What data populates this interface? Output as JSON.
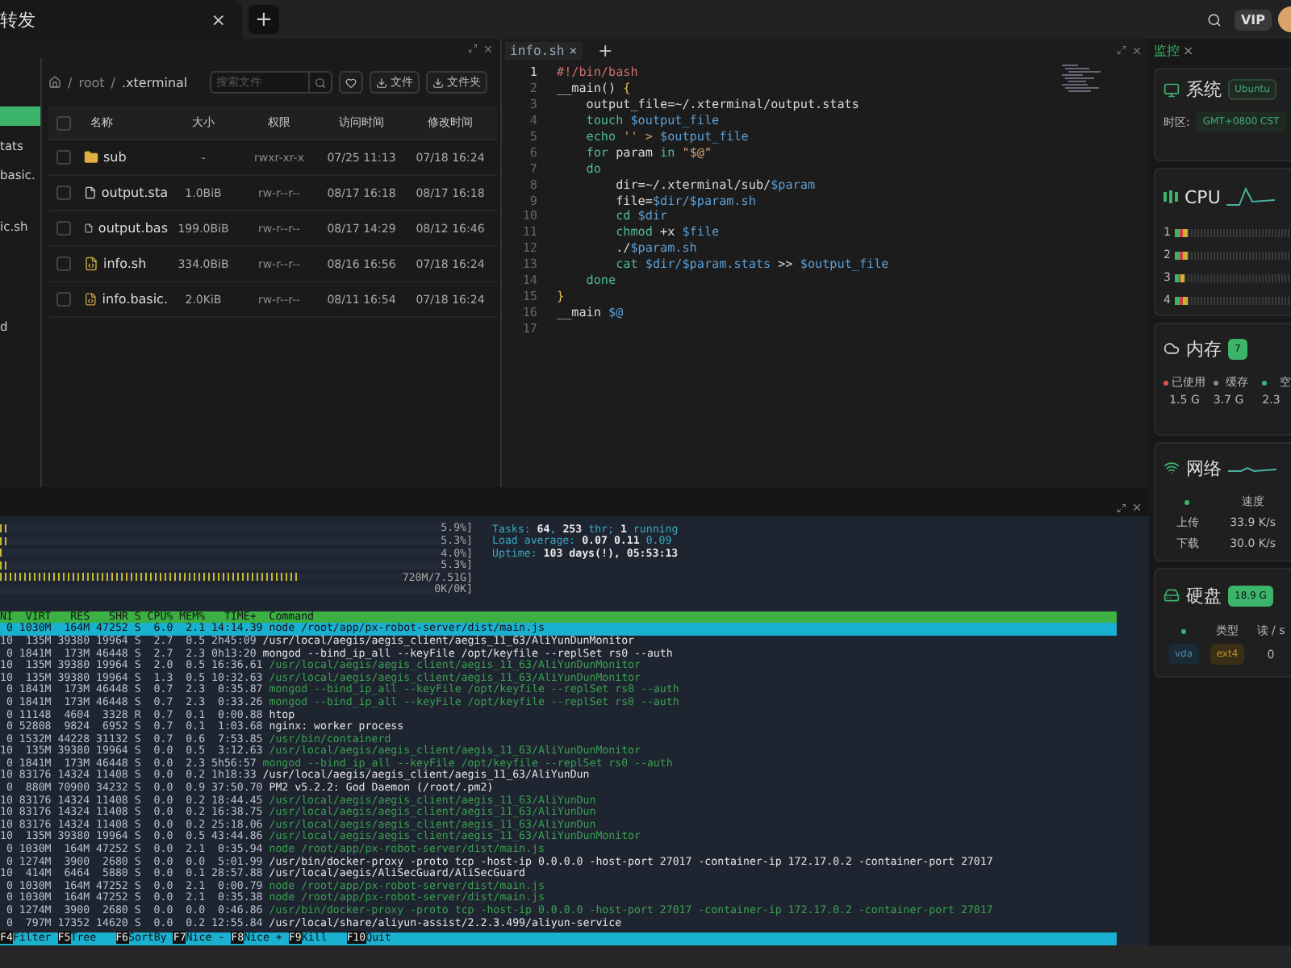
{
  "top_bar": {
    "tab": {
      "label": "转发",
      "close": "×"
    },
    "new_tab": "+",
    "vip": "VIP"
  },
  "sidebar": {
    "items": [
      {
        "label": "tats"
      },
      {
        "label": "basic."
      },
      {
        "label": "ic.sh"
      },
      {
        "label": "d"
      }
    ]
  },
  "file_manager": {
    "breadcrumb": [
      "root",
      ".xterminal"
    ],
    "separator": "/",
    "search": {
      "placeholder": "搜索文件"
    },
    "buttons": [
      "文件",
      "文件夹"
    ],
    "all_selected": false,
    "columns": [
      "名称",
      "大小",
      "权限",
      "访问时间",
      "修改时间"
    ],
    "rows": [
      {
        "kind": "folder",
        "name": "sub",
        "size": "-",
        "perm": "rwxr-xr-x",
        "accessed": "07/25 11:13",
        "modified": "07/18 16:24",
        "checked": false
      },
      {
        "kind": "file",
        "name": "output.sta",
        "size": "1.0BiB",
        "perm": "rw-r--r--",
        "accessed": "08/17 16:18",
        "modified": "08/17 16:18",
        "checked": false
      },
      {
        "kind": "file",
        "name": "output.bas",
        "size": "199.0BiB",
        "perm": "rw-r--r--",
        "accessed": "08/17 14:29",
        "modified": "08/12 16:46",
        "checked": false
      },
      {
        "kind": "script",
        "name": "info.sh",
        "size": "334.0BiB",
        "perm": "rw-r--r--",
        "accessed": "08/16 16:56",
        "modified": "07/18 16:24",
        "checked": false
      },
      {
        "kind": "script",
        "name": "info.basic.",
        "size": "2.0KiB",
        "perm": "rw-r--r--",
        "accessed": "08/11 16:54",
        "modified": "07/18 16:24",
        "checked": false
      }
    ]
  },
  "editor": {
    "tab": {
      "label": "info.sh",
      "close": "×"
    },
    "new_tab": "+",
    "lines": [
      {
        "number": "1",
        "tokens": [
          {
            "kind": "comment",
            "text": "#!/bin/bash"
          }
        ]
      },
      {
        "number": "2",
        "tokens": [
          {
            "kind": "plain",
            "text": "__main() "
          },
          {
            "kind": "brace",
            "text": "{"
          }
        ]
      },
      {
        "number": "3",
        "tokens": [
          {
            "kind": "plain",
            "text": "    output_file=~/.xterminal/output.stats"
          }
        ]
      },
      {
        "number": "4",
        "tokens": [
          {
            "kind": "keyword",
            "text": "    touch"
          },
          {
            "kind": "variable",
            "text": " $output_file"
          }
        ]
      },
      {
        "number": "5",
        "tokens": [
          {
            "kind": "keyword",
            "text": "    echo"
          },
          {
            "kind": "string",
            "text": " '' > "
          },
          {
            "kind": "variable",
            "text": "$output_file"
          }
        ]
      },
      {
        "number": "6",
        "tokens": [
          {
            "kind": "keyword",
            "text": "    for"
          },
          {
            "kind": "plain",
            "text": " param "
          },
          {
            "kind": "keyword",
            "text": "in"
          },
          {
            "kind": "string",
            "text": " \"$@\""
          }
        ]
      },
      {
        "number": "7",
        "tokens": [
          {
            "kind": "keyword",
            "text": "    do"
          }
        ]
      },
      {
        "number": "8",
        "tokens": [
          {
            "kind": "plain",
            "text": "        dir=~/.xterminal/sub/"
          },
          {
            "kind": "variable",
            "text": "$param"
          }
        ]
      },
      {
        "number": "9",
        "tokens": [
          {
            "kind": "plain",
            "text": "        file="
          },
          {
            "kind": "variable",
            "text": "$dir/$param.sh"
          }
        ]
      },
      {
        "number": "10",
        "tokens": [
          {
            "kind": "keyword",
            "text": "        cd"
          },
          {
            "kind": "variable",
            "text": " $dir"
          }
        ]
      },
      {
        "number": "11",
        "tokens": [
          {
            "kind": "keyword",
            "text": "        chmod"
          },
          {
            "kind": "plain",
            "text": " +x"
          },
          {
            "kind": "variable",
            "text": " $file"
          }
        ]
      },
      {
        "number": "12",
        "tokens": [
          {
            "kind": "plain",
            "text": "        ./"
          },
          {
            "kind": "variable",
            "text": "$param.sh"
          }
        ]
      },
      {
        "number": "13",
        "tokens": [
          {
            "kind": "keyword",
            "text": "        cat"
          },
          {
            "kind": "variable",
            "text": " $dir/$param.stats"
          },
          {
            "kind": "plain",
            "text": " >> "
          },
          {
            "kind": "variable",
            "text": "$output_file"
          }
        ]
      },
      {
        "number": "14",
        "tokens": [
          {
            "kind": "keyword",
            "text": "    done"
          }
        ]
      },
      {
        "number": "15",
        "tokens": [
          {
            "kind": "brace",
            "text": "}"
          }
        ]
      },
      {
        "number": "16",
        "tokens": [
          {
            "kind": "plain",
            "text": "__main"
          },
          {
            "kind": "variable",
            "text": " $@"
          }
        ]
      },
      {
        "number": "17"
      }
    ]
  },
  "terminal": {
    "meters": [
      {
        "reading": "5.9%]",
        "level": 0.02
      },
      {
        "reading": "5.3%]",
        "level": 0.02
      },
      {
        "reading": "4.0%]",
        "level": 0.01
      },
      {
        "reading": "5.3%]",
        "level": 0.02
      },
      {
        "reading": "720M/7.51G]",
        "level": 0.74
      },
      {
        "reading": "0K/0K]",
        "level": 0
      }
    ],
    "summary": [
      "Tasks: **64**, **253** thr; **1** running",
      "Load average: **0.07** **0.11** 0.09",
      "Uptime: **103 days(!), 05:53:13**"
    ],
    "header": "NI  VIRT   RES   SHR S CPU% MEM%   TIME+  Command",
    "processes": [
      {
        "stats": " 0 1030M  164M 47252 S  6.0  2.1 14:14.39",
        "command": "node /root/app/px-robot-server/dist/main.js",
        "kind": "process",
        "selected": true
      },
      {
        "stats": "10  135M 39380 19964 S  2.7  0.5 2h45:09",
        "command": "/usr/local/aegis/aegis_client/aegis_11_63/AliYunDunMonitor",
        "kind": "process",
        "selected": false
      },
      {
        "stats": " 0 1841M  173M 46448 S  2.7  2.3 0h13:20",
        "command": "mongod --bind_ip_all --keyFile /opt/keyfile --replSet rs0 --auth",
        "kind": "process",
        "selected": false
      },
      {
        "stats": "10  135M 39380 19964 S  2.0  0.5 16:36.61",
        "command": "/usr/local/aegis/aegis_client/aegis_11_63/AliYunDunMonitor",
        "kind": "thread",
        "selected": false
      },
      {
        "stats": "10  135M 39380 19964 S  1.3  0.5 10:32.63",
        "command": "/usr/local/aegis/aegis_client/aegis_11_63/AliYunDunMonitor",
        "kind": "thread",
        "selected": false
      },
      {
        "stats": " 0 1841M  173M 46448 S  0.7  2.3  0:35.87",
        "command": "mongod --bind_ip_all --keyFile /opt/keyfile --replSet rs0 --auth",
        "kind": "thread",
        "selected": false
      },
      {
        "stats": " 0 1841M  173M 46448 S  0.7  2.3  0:33.26",
        "command": "mongod --bind_ip_all --keyFile /opt/keyfile --replSet rs0 --auth",
        "kind": "thread",
        "selected": false
      },
      {
        "stats": " 0 11148  4604  3328 R  0.7  0.1  0:00.88",
        "command": "htop",
        "kind": "process",
        "selected": false
      },
      {
        "stats": " 0 52808  9824  6952 S  0.7  0.1  1:03.68",
        "command": "nginx: worker process",
        "kind": "process",
        "selected": false
      },
      {
        "stats": " 0 1532M 44228 31132 S  0.7  0.6  7:53.85",
        "command": "/usr/bin/containerd",
        "kind": "thread",
        "selected": false
      },
      {
        "stats": "10  135M 39380 19964 S  0.0  0.5  3:12.63",
        "command": "/usr/local/aegis/aegis_client/aegis_11_63/AliYunDunMonitor",
        "kind": "thread",
        "selected": false
      },
      {
        "stats": " 0 1841M  173M 46448 S  0.0  2.3 5h56:57",
        "command": "mongod --bind_ip_all --keyFile /opt/keyfile --replSet rs0 --auth",
        "kind": "thread",
        "selected": false
      },
      {
        "stats": "10 83176 14324 11408 S  0.0  0.2 1h18:33",
        "command": "/usr/local/aegis/aegis_client/aegis_11_63/AliYunDun",
        "kind": "process",
        "selected": false
      },
      {
        "stats": " 0  880M 70900 34232 S  0.0  0.9 37:50.70",
        "command": "PM2 v5.2.2: God Daemon (/root/.pm2)",
        "kind": "process",
        "selected": false
      },
      {
        "stats": "10 83176 14324 11408 S  0.0  0.2 18:44.45",
        "command": "/usr/local/aegis/aegis_client/aegis_11_63/AliYunDun",
        "kind": "thread",
        "selected": false
      },
      {
        "stats": "10 83176 14324 11408 S  0.0  0.2 16:38.75",
        "command": "/usr/local/aegis/aegis_client/aegis_11_63/AliYunDun",
        "kind": "thread",
        "selected": false
      },
      {
        "stats": "10 83176 14324 11408 S  0.0  0.2 25:18.06",
        "command": "/usr/local/aegis/aegis_client/aegis_11_63/AliYunDun",
        "kind": "thread",
        "selected": false
      },
      {
        "stats": "10  135M 39380 19964 S  0.0  0.5 43:44.86",
        "command": "/usr/local/aegis/aegis_client/aegis_11_63/AliYunDunMonitor",
        "kind": "thread",
        "selected": false
      },
      {
        "stats": " 0 1030M  164M 47252 S  0.0  2.1  0:35.94",
        "command": "node /root/app/px-robot-server/dist/main.js",
        "kind": "thread",
        "selected": false
      },
      {
        "stats": " 0 1274M  3900  2680 S  0.0  0.0  5:01.99",
        "command": "/usr/bin/docker-proxy -proto tcp -host-ip 0.0.0.0 -host-port 27017 -container-ip 172.17.0.2 -container-port 27017",
        "kind": "process",
        "selected": false
      },
      {
        "stats": "10  414M  6464  5880 S  0.0  0.1 28:57.88",
        "command": "/usr/local/aegis/AliSecGuard/AliSecGuard",
        "kind": "process",
        "selected": false
      },
      {
        "stats": " 0 1030M  164M 47252 S  0.0  2.1  0:00.79",
        "command": "node /root/app/px-robot-server/dist/main.js",
        "kind": "thread",
        "selected": false
      },
      {
        "stats": " 0 1030M  164M 47252 S  0.0  2.1  0:35.38",
        "command": "node /root/app/px-robot-server/dist/main.js",
        "kind": "thread",
        "selected": false
      },
      {
        "stats": " 0 1274M  3900  2680 S  0.0  0.0  0:46.86",
        "command": "/usr/bin/docker-proxy -proto tcp -host-ip 0.0.0.0 -host-port 27017 -container-ip 172.17.0.2 -container-port 27017",
        "kind": "thread",
        "selected": false
      },
      {
        "stats": " 0  797M 17352 14620 S  0.0  0.2 12:55.84",
        "command": "/usr/local/share/aliyun-assist/2.2.3.499/aliyun-service",
        "kind": "process",
        "selected": false
      }
    ],
    "function_keys": [
      {
        "key": "F4",
        "label": "Filter"
      },
      {
        "key": "F5",
        "label": "Tree  "
      },
      {
        "key": "F6",
        "label": "SortBy"
      },
      {
        "key": "F7",
        "label": "Nice -"
      },
      {
        "key": "F8",
        "label": "Nice +"
      },
      {
        "key": "F9",
        "label": "Kill  "
      },
      {
        "key": "F10",
        "label": "Quit"
      }
    ]
  },
  "monitor": {
    "tab": {
      "label": "监控",
      "close": "×"
    },
    "system": {
      "title": "系统",
      "badge": "Ubuntu",
      "timezone_label": "时区:",
      "timezone": "GMT+0800 CST"
    },
    "cpu": {
      "title": "CPU",
      "cores": [
        {
          "label": "1",
          "level": 0.1
        },
        {
          "label": "2",
          "level": 0.1
        },
        {
          "label": "3",
          "level": 0.08
        },
        {
          "label": "4",
          "level": 0.1
        }
      ]
    },
    "memory": {
      "title": "内存",
      "badge": "7",
      "legend": [
        {
          "label": "已使用",
          "value": "1.5 G",
          "color": "#e05050"
        },
        {
          "label": "缓存",
          "value": "3.7 G",
          "color": "#8a8a8a"
        },
        {
          "label": "空",
          "value": "2.3",
          "color": "#3cb371"
        }
      ]
    },
    "network": {
      "title": "网络",
      "column": "速度",
      "rows": [
        {
          "label": "上传",
          "value": "33.9 K/s"
        },
        {
          "label": "下载",
          "value": "30.0 K/s"
        }
      ]
    },
    "disk": {
      "title": "硬盘",
      "badge": "18.9 G",
      "columns": [
        "类型",
        "读 / s"
      ],
      "rows": [
        {
          "device": "vda",
          "type": "ext4",
          "read": "0"
        }
      ]
    }
  }
}
